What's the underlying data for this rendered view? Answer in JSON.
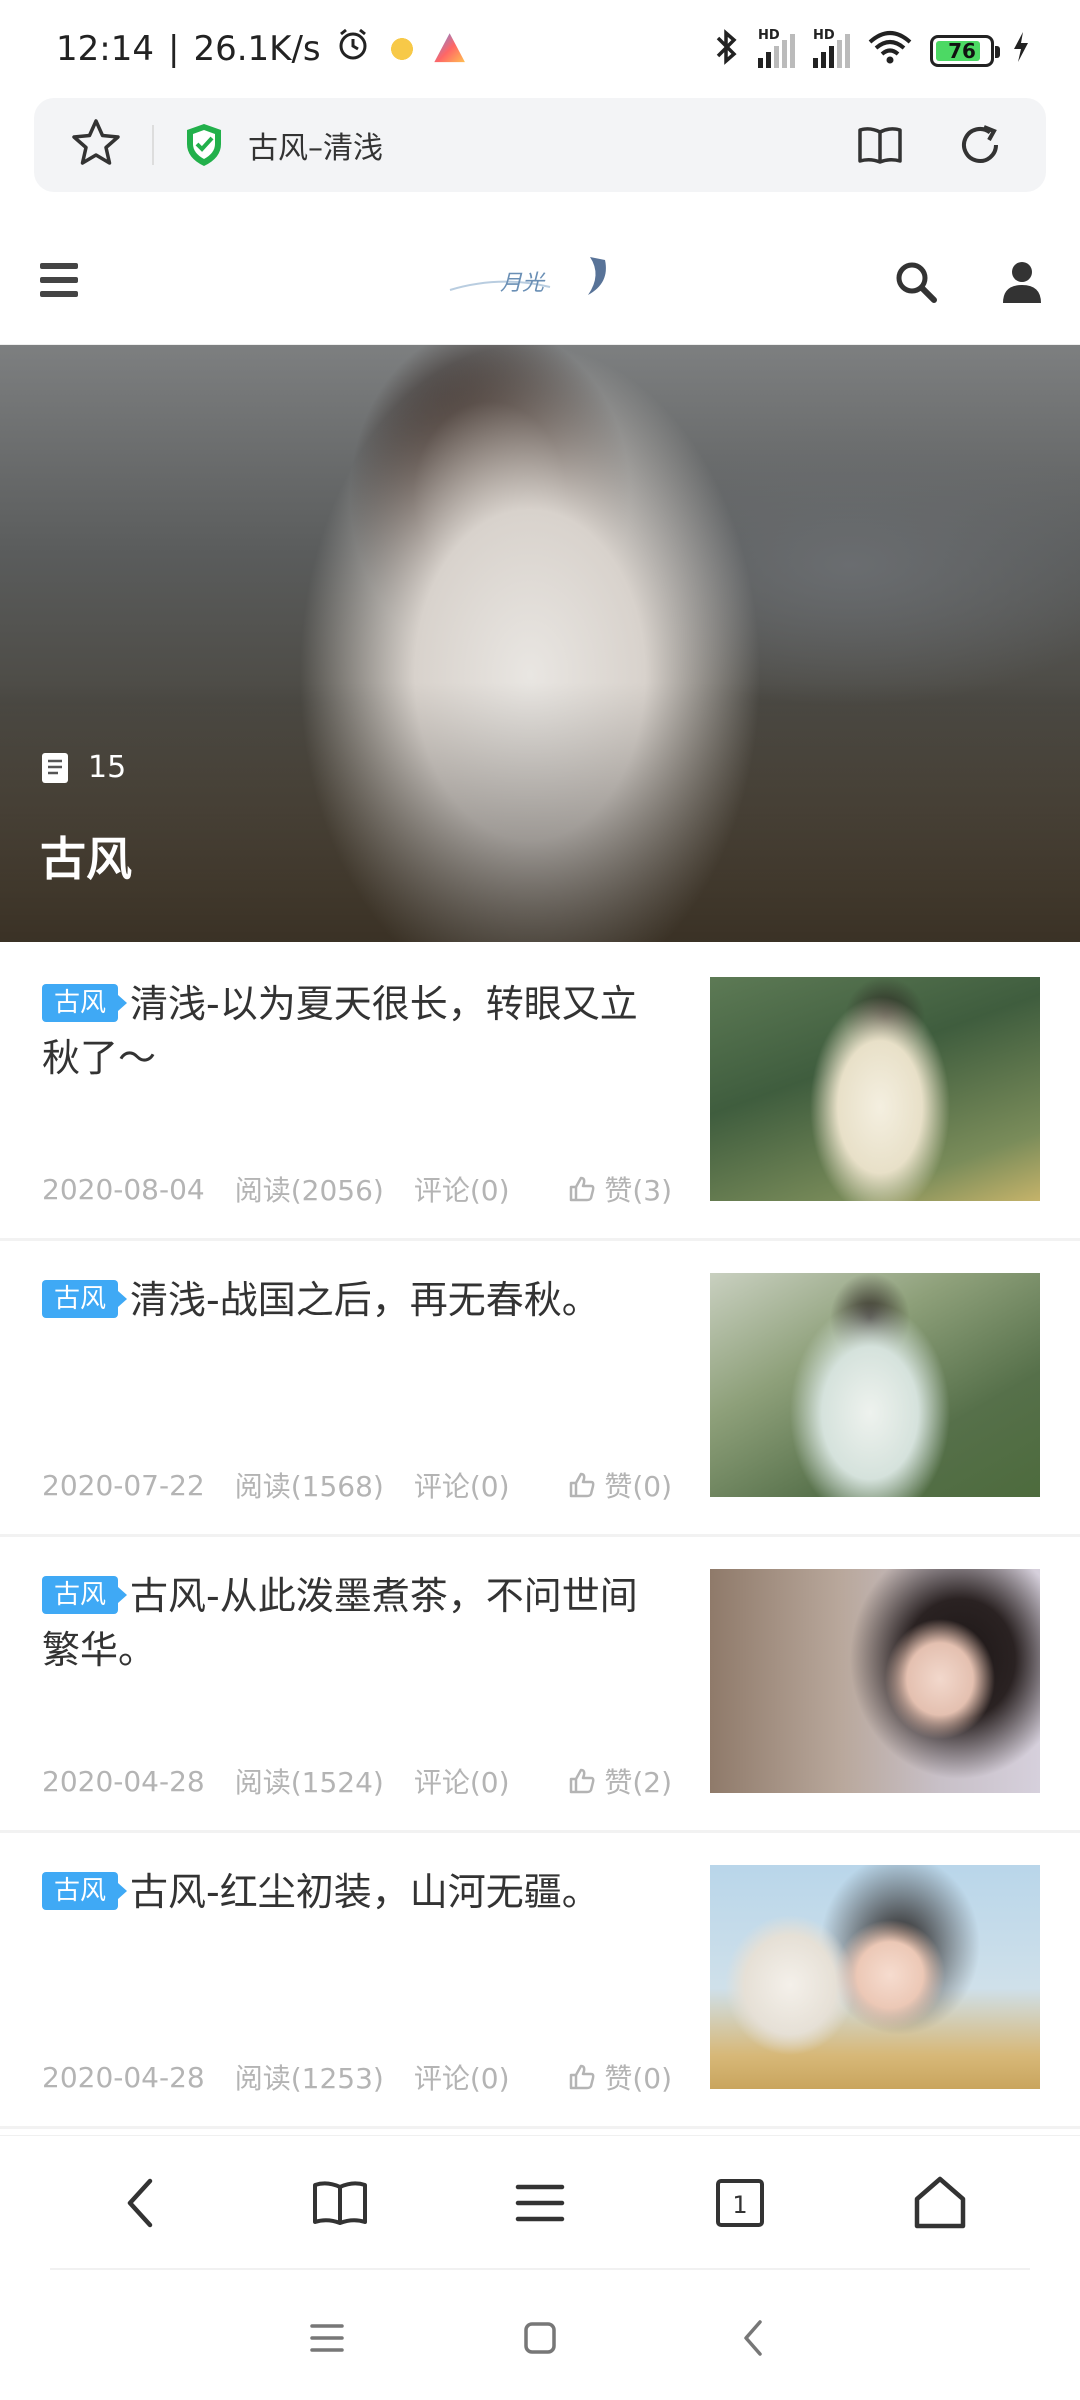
{
  "status_bar": {
    "time": "12:14",
    "network_speed": "26.1K/s",
    "battery_level": "76",
    "signal_label": "HD"
  },
  "browser": {
    "page_title": "古风–清浅"
  },
  "site": {
    "logo_text": "月光"
  },
  "hero": {
    "count": "15",
    "category_title": "古风"
  },
  "articles": [
    {
      "tag": "古风",
      "title": "清浅-以为夏天很长，转眼又立秋了～",
      "date": "2020-08-04",
      "reads": "阅读(2056)",
      "comments": "评论(0)",
      "likes": "赞(3)"
    },
    {
      "tag": "古风",
      "title": "清浅-战国之后，再无春秋。",
      "date": "2020-07-22",
      "reads": "阅读(1568)",
      "comments": "评论(0)",
      "likes": "赞(0)"
    },
    {
      "tag": "古风",
      "title": "古风-从此泼墨煮茶，不问世间繁华。",
      "date": "2020-04-28",
      "reads": "阅读(1524)",
      "comments": "评论(0)",
      "likes": "赞(2)"
    },
    {
      "tag": "古风",
      "title": "古风-红尘初装，山河无疆。",
      "date": "2020-04-28",
      "reads": "阅读(1253)",
      "comments": "评论(0)",
      "likes": "赞(0)"
    }
  ],
  "toolbar": {
    "tab_count": "1"
  },
  "colors": {
    "tag_blue": "#3fa9f5",
    "shield_green": "#22b04b",
    "battery_green": "#4cd964"
  }
}
